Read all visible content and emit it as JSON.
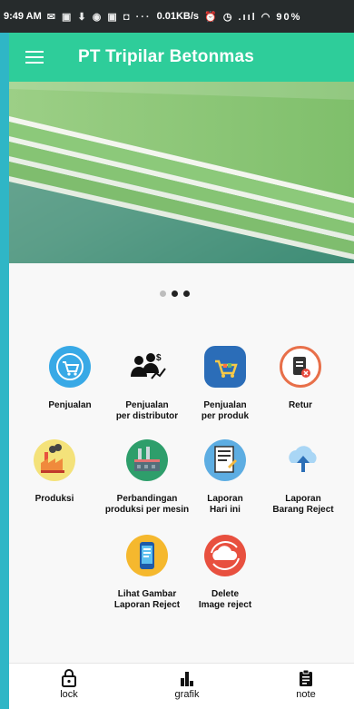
{
  "status_bar": {
    "time": "9:49 AM",
    "icons": "✉ ▣ ⬇ ◉ ▣ ◘ ···",
    "network": "0.01KB/s",
    "right": "⏰ ◷ .ııl ◠ 90%"
  },
  "app_bar": {
    "title": "PT Tripilar Betonmas"
  },
  "carousel": {
    "pages": 3,
    "active": 1
  },
  "menu": [
    {
      "label": "Penjualan"
    },
    {
      "label": "Penjualan\nper distributor"
    },
    {
      "label": "Penjualan\nper produk"
    },
    {
      "label": "Retur"
    },
    {
      "label": "Produksi"
    },
    {
      "label": "Perbandingan\nproduksi per mesin"
    },
    {
      "label": "Laporan\nHari ini"
    },
    {
      "label": "Laporan\nBarang Reject"
    },
    {
      "label": "Lihat Gambar\nLaporan Reject"
    },
    {
      "label": "Delete\nImage reject"
    }
  ],
  "bottom_nav": [
    {
      "label": "lock",
      "icon": "lock-icon"
    },
    {
      "label": "grafik",
      "icon": "bar-chart-icon"
    },
    {
      "label": "note",
      "icon": "clipboard-icon"
    }
  ],
  "colors": {
    "app_bar": "#2ecd9a",
    "status_bar": "#262b2c",
    "accent_edge": "#2fb6c6"
  }
}
